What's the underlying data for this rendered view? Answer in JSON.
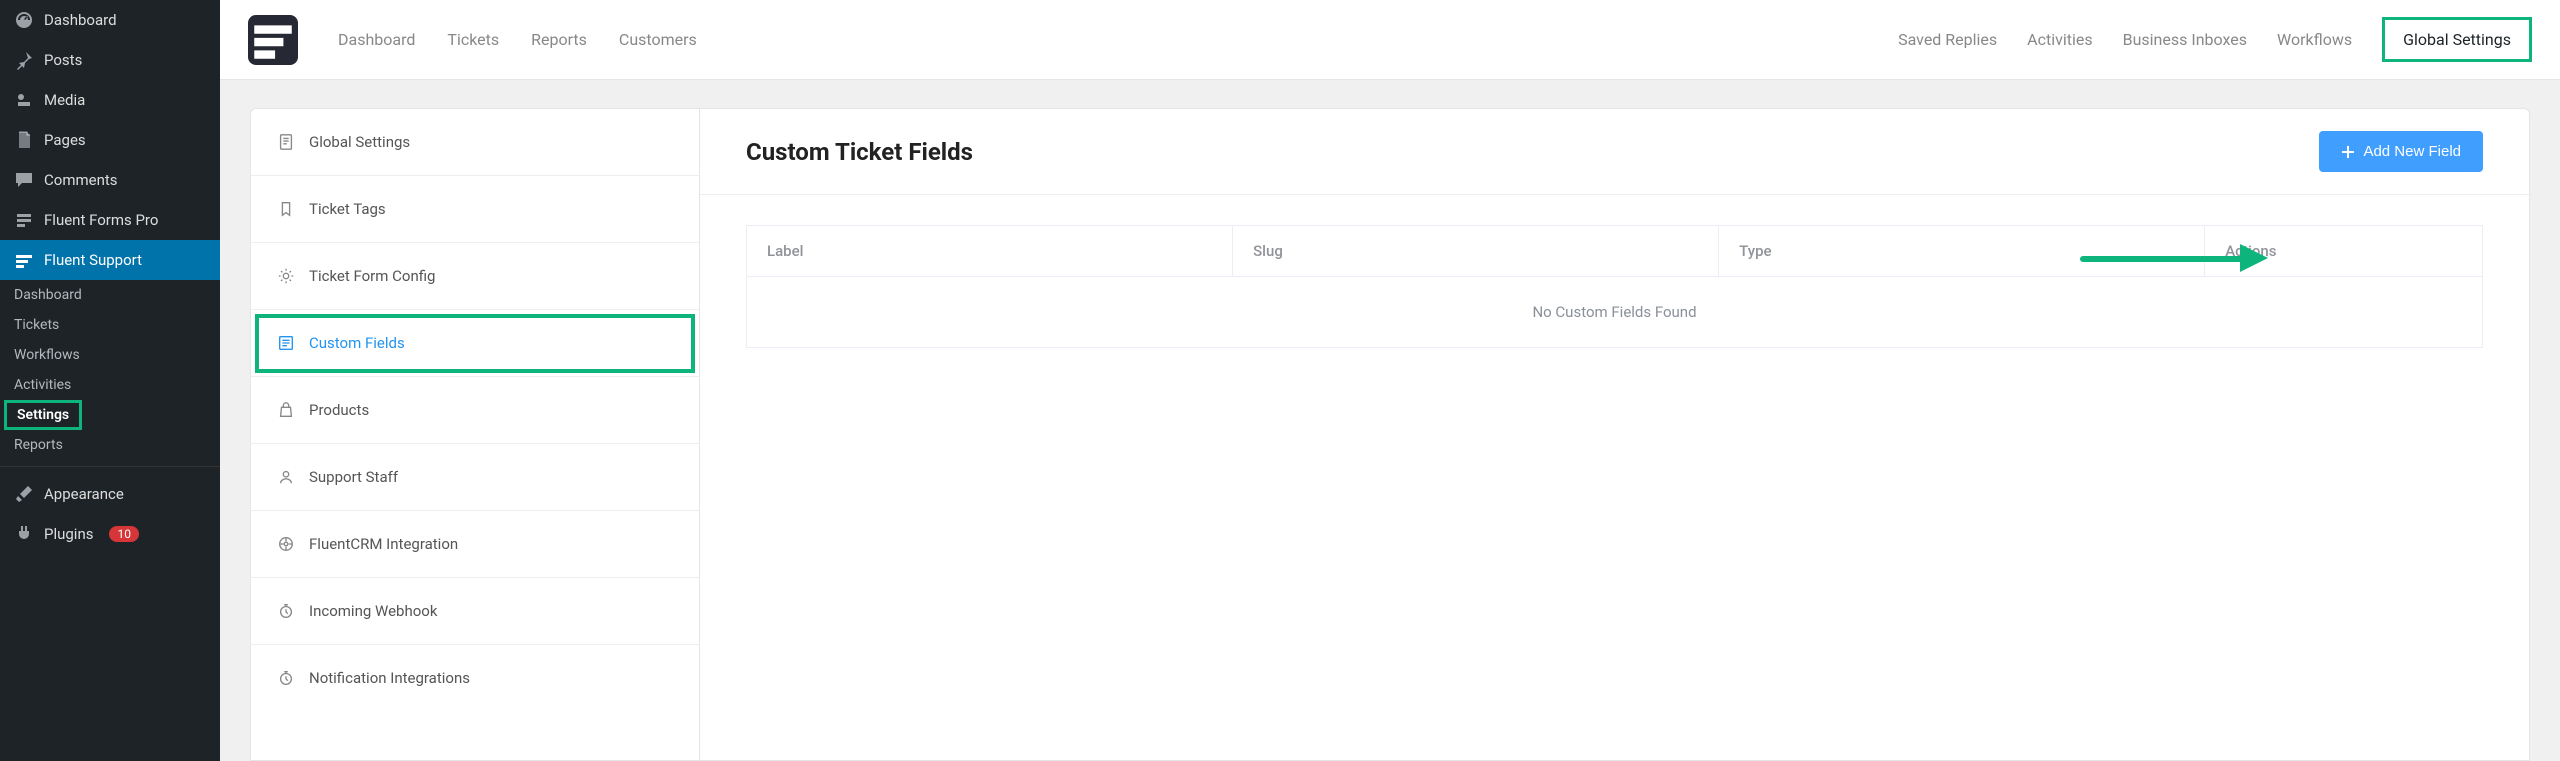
{
  "wp_menu": {
    "dashboard": "Dashboard",
    "posts": "Posts",
    "media": "Media",
    "pages": "Pages",
    "comments": "Comments",
    "fluent_forms": "Fluent Forms Pro",
    "fluent_support": "Fluent Support",
    "appearance": "Appearance",
    "plugins": "Plugins",
    "plugins_count": "10"
  },
  "wp_submenu": {
    "dashboard": "Dashboard",
    "tickets": "Tickets",
    "workflows": "Workflows",
    "activities": "Activities",
    "settings": "Settings",
    "reports": "Reports"
  },
  "topnav": {
    "dashboard": "Dashboard",
    "tickets": "Tickets",
    "reports": "Reports",
    "customers": "Customers"
  },
  "toprnav": {
    "saved_replies": "Saved Replies",
    "activities": "Activities",
    "inboxes": "Business Inboxes",
    "workflows": "Workflows",
    "global_settings": "Global Settings"
  },
  "settings_nav": {
    "global": "Global Settings",
    "tags": "Ticket Tags",
    "form": "Ticket Form Config",
    "custom": "Custom Fields",
    "products": "Products",
    "staff": "Support Staff",
    "crm": "FluentCRM Integration",
    "webhook": "Incoming Webhook",
    "notif": "Notification Integrations"
  },
  "page": {
    "title": "Custom Ticket Fields",
    "add_btn": "Add New Field",
    "empty": "No Custom Fields Found",
    "cols": {
      "label": "Label",
      "slug": "Slug",
      "type": "Type",
      "actions": "Actions"
    }
  }
}
